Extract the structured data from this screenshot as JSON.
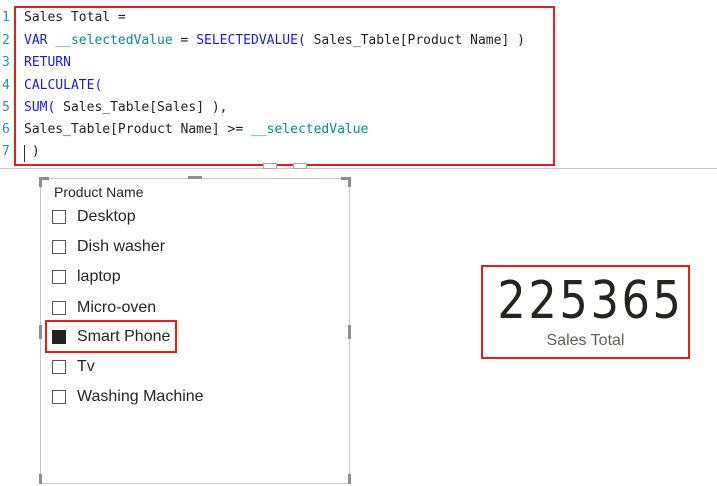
{
  "editor": {
    "lines": [
      {
        "number": "1",
        "tokens": [
          {
            "text": "Sales Total ="
          }
        ]
      },
      {
        "number": "2",
        "tokens": [
          {
            "text": "VAR",
            "kind": "kw"
          },
          {
            "text": " "
          },
          {
            "text": "__selectedValue",
            "kind": "var"
          },
          {
            "text": " = "
          },
          {
            "text": "SELECTEDVALUE(",
            "kind": "fn"
          },
          {
            "text": " Sales_Table[Product Name] )"
          }
        ]
      },
      {
        "number": "3",
        "tokens": [
          {
            "text": "RETURN",
            "kind": "kw"
          }
        ]
      },
      {
        "number": "4",
        "tokens": [
          {
            "text": "CALCULATE(",
            "kind": "fn"
          }
        ]
      },
      {
        "number": "5",
        "tokens": [
          {
            "text": "SUM(",
            "kind": "fn"
          },
          {
            "text": " Sales_Table[Sales] ),"
          }
        ]
      },
      {
        "number": "6",
        "tokens": [
          {
            "text": "Sales_Table[Product Name] >= "
          },
          {
            "text": "__selectedValue",
            "kind": "var"
          }
        ]
      },
      {
        "number": "7",
        "tokens": [
          {
            "text": " )"
          }
        ]
      }
    ]
  },
  "slicer": {
    "header": "Product Name",
    "items": [
      {
        "label": "Desktop",
        "checked": false
      },
      {
        "label": "Dish washer",
        "checked": false
      },
      {
        "label": "laptop",
        "checked": false
      },
      {
        "label": "Micro-oven",
        "checked": false
      },
      {
        "label": "Smart Phone",
        "checked": true
      },
      {
        "label": "Tv",
        "checked": false
      },
      {
        "label": "Washing Machine",
        "checked": false
      }
    ]
  },
  "card": {
    "value": "225365",
    "label": "Sales Total"
  },
  "colors": {
    "highlight": "#e02020",
    "keyword": "#1a1ad6",
    "variable": "#0a8a8a",
    "line_number": "#2b91af"
  }
}
